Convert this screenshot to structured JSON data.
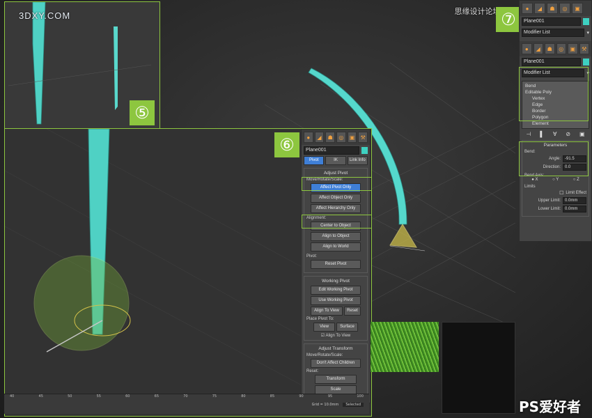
{
  "watermarks": {
    "site_left": "3DXY.COM",
    "site_right": "思缘设计论坛 www.MISSYUAN.COM",
    "footer": "PS爱好者"
  },
  "badges": {
    "five": "⑤",
    "six": "⑥",
    "seven": "⑦"
  },
  "colors": {
    "accent": "#8dc63f",
    "object": "#3ed1c1",
    "active_button": "#3f7fd6"
  },
  "panel_right": {
    "top_name": "Plane001",
    "top_list": "Modifier List",
    "name": "Plane001",
    "modifier_list": "Modifier List",
    "stack": [
      "Bend",
      "Editable Poly",
      "Vertex",
      "Edge",
      "Border",
      "Polygon",
      "Element"
    ],
    "parameters_title": "Parameters",
    "bend_label": "Bend:",
    "angle_label": "Angle:",
    "angle_value": "-91.5",
    "direction_label": "Direction:",
    "direction_value": "0.0",
    "bend_axis_label": "Bend Axis:",
    "axes": [
      "X",
      "Y",
      "Z"
    ],
    "limits_label": "Limits",
    "limit_effect": "Limit Effect",
    "upper_label": "Upper Limit:",
    "upper_value": "0.0mm",
    "lower_label": "Lower Limit:",
    "lower_value": "0.0mm"
  },
  "panel_hierarchy": {
    "name": "Plane001",
    "tabs": [
      "Pivot",
      "IK",
      "Link Info"
    ],
    "adjust_pivot": "Adjust Pivot",
    "move_rotate_scale": "Move/Rotate/Scale:",
    "affect_pivot": "Affect Pivot Only",
    "affect_object": "Affect Object Only",
    "affect_hierarchy": "Affect Hierarchy Only",
    "alignment": "Alignment:",
    "center_object": "Center to Object",
    "align_object": "Align to Object",
    "align_world": "Align to World",
    "pivot_label": "Pivot:",
    "reset_pivot": "Reset Pivot",
    "working_pivot": "Working Pivot",
    "edit_working": "Edit Working Pivot",
    "use_working": "Use Working Pivot",
    "align_view": "Align To View",
    "reset": "Reset",
    "place_pivot": "Place Pivot To:",
    "view": "View",
    "surface": "Surface",
    "align_to_view_cb": "Align To View",
    "adjust_transform": "Adjust Transform",
    "mrs2": "Move/Rotate/Scale:",
    "dont_affect": "Don't Affect Children",
    "reset2": "Reset:",
    "transform": "Transform",
    "scale": "Scale"
  },
  "timeline": {
    "ticks": [
      "40",
      "45",
      "50",
      "55",
      "60",
      "65",
      "70",
      "75",
      "80",
      "85",
      "90",
      "95",
      "100"
    ],
    "grid": "Grid = 10.0mm",
    "selected": "Selected"
  }
}
